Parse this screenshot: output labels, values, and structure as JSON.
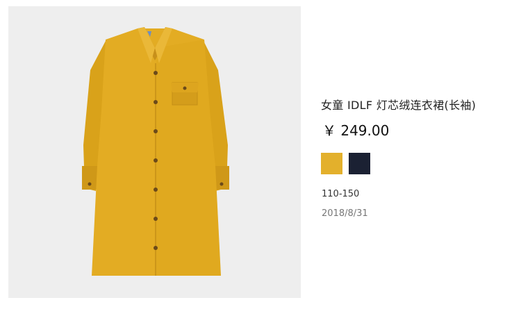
{
  "product": {
    "image_alt": "yellow corduroy shirt dress",
    "title": "女童 IDLF 灯芯绒连衣裙(长袖)",
    "price": "￥ 249.00",
    "colors": [
      {
        "name": "yellow",
        "hex": "#e3b02c"
      },
      {
        "name": "navy",
        "hex": "#1b2133"
      }
    ],
    "size_range": "110-150",
    "date": "2018/8/31"
  }
}
